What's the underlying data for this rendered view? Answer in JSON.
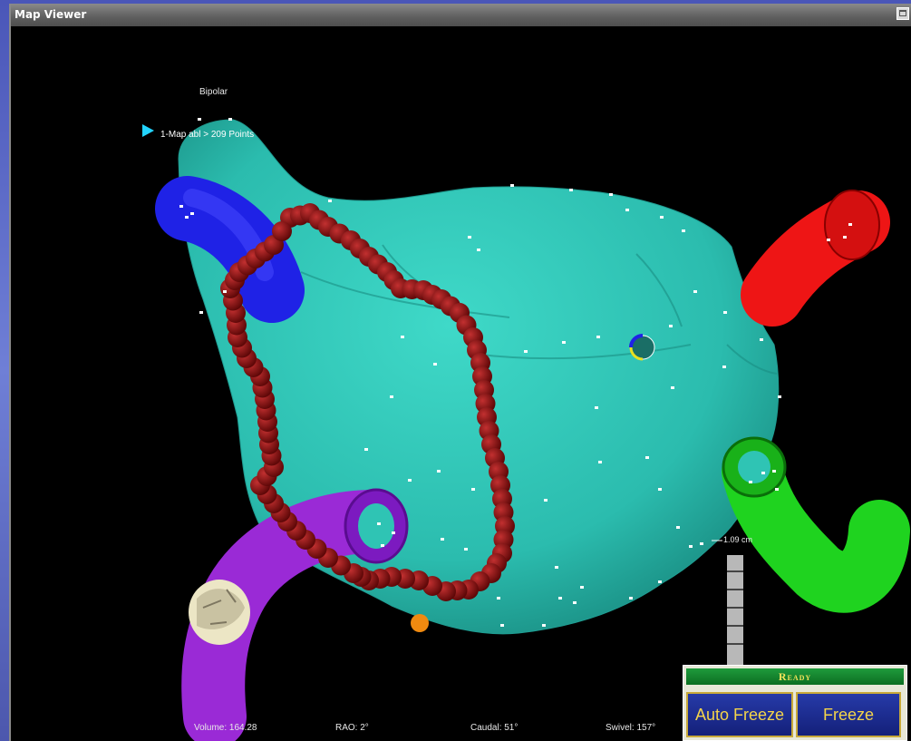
{
  "window": {
    "title": "Map Viewer"
  },
  "viewer": {
    "mode_label": "Bipolar",
    "map_label": "1-Map abl > 209 Points",
    "scale_label": "1.09 cm",
    "footer": {
      "volume": "Volume: 164.28",
      "rao": "RAO: 2°",
      "caudal": "Caudal: 51°",
      "swivel": "Swivel: 157°"
    }
  },
  "panel": {
    "status": "Ready",
    "auto_freeze_label": "Auto Freeze",
    "freeze_label": "Freeze"
  },
  "colors": {
    "chamber": "#2fc4b4",
    "lesion": "#8a1010",
    "vein_blue": "#1f22e6",
    "vein_red": "#ee1515",
    "vein_green": "#1fd31f",
    "vein_purple": "#9a2ad6",
    "catheter_marker": "#f08a10",
    "status_green": "#1f9b3c",
    "button_blue": "#1a2a92",
    "button_text": "#f4d44a"
  }
}
